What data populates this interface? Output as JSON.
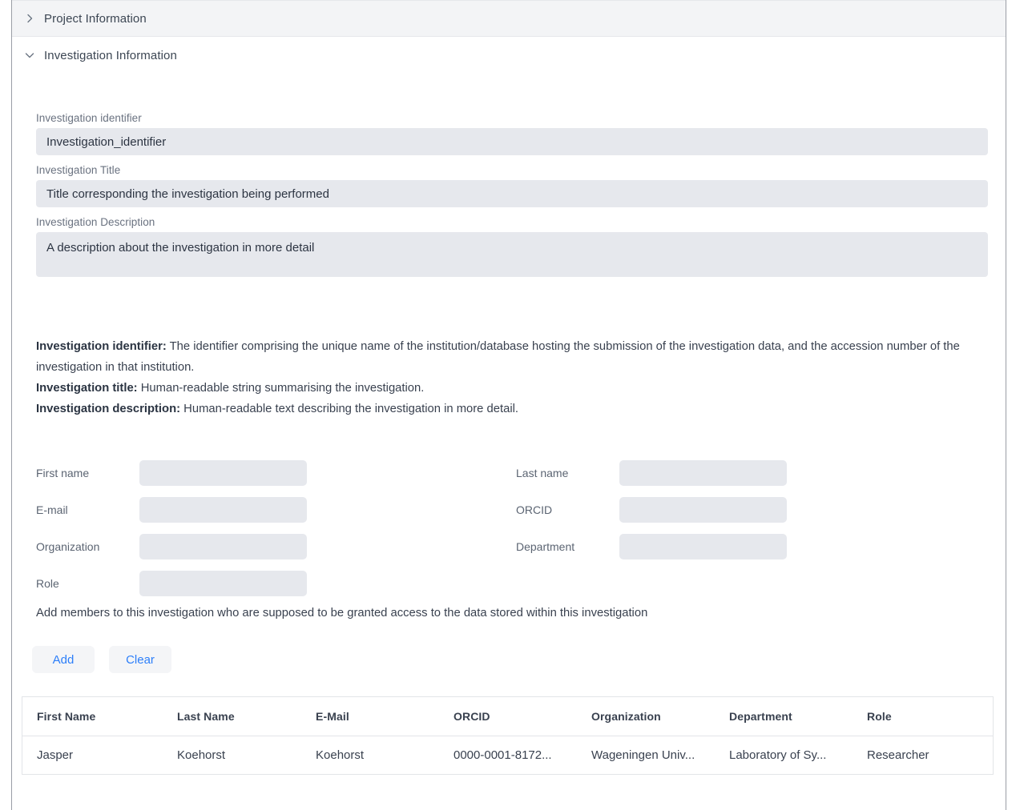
{
  "accordion": {
    "project_section": {
      "title": "Project Information",
      "state": "collapsed",
      "icon": "chevron-right-icon"
    },
    "investigation_section": {
      "title": "Investigation Information",
      "state": "expanded",
      "icon": "chevron-down-icon"
    }
  },
  "investigation": {
    "identifier": {
      "label": "Investigation identifier",
      "value": "Investigation_identifier",
      "placeholder": "Investigation_identifier"
    },
    "title": {
      "label": "Investigation Title",
      "value": "Title corresponding the investigation being performed",
      "placeholder": "Title corresponding the investigation being performed"
    },
    "description": {
      "label": "Investigation Description",
      "value": "A description about the investigation in more detail",
      "placeholder": "A description about the investigation in more detail"
    }
  },
  "help_text": {
    "identifier_term": "Investigation identifier:",
    "identifier_body": " The identifier comprising the unique name of the institution/database hosting the submission of the investigation data, and the accession number of the investigation in that institution.",
    "title_term": "Investigation title:",
    "title_body": " Human-readable string summarising the investigation.",
    "description_term": "Investigation description:",
    "description_body": " Human-readable text describing the investigation in more detail."
  },
  "member_form": {
    "left_fields": [
      {
        "label": "First name",
        "value": "",
        "placeholder": ""
      },
      {
        "label": "E-mail",
        "value": "",
        "placeholder": ""
      },
      {
        "label": "Organization",
        "value": "",
        "placeholder": ""
      },
      {
        "label": "Role",
        "value": "",
        "placeholder": ""
      }
    ],
    "right_fields": [
      {
        "label": "Last name",
        "value": "",
        "placeholder": ""
      },
      {
        "label": "ORCID",
        "value": "",
        "placeholder": ""
      },
      {
        "label": "Department",
        "value": "",
        "placeholder": ""
      }
    ],
    "note": "Add members to this investigation who are supposed to be granted access to the data stored within this investigation",
    "add_label": "Add",
    "clear_label": "Clear"
  },
  "members_table": {
    "columns": [
      "First Name",
      "Last Name",
      "E-Mail",
      "ORCID",
      "Organization",
      "Department",
      "Role"
    ],
    "rows": [
      {
        "first_name": "Jasper",
        "last_name": "Koehorst",
        "email": "Koehorst",
        "orcid": "0000-0001-8172...",
        "organization": "Wageningen Univ...",
        "department": "Laboratory of Sy...",
        "role": "Researcher"
      }
    ]
  },
  "colors": {
    "accent_blue": "#2d7ff9",
    "input_bg": "#e6e8ed",
    "header_bg": "#f3f4f6",
    "text_primary": "#39414f",
    "text_muted": "#6a7280",
    "border": "#e3e5e8"
  }
}
